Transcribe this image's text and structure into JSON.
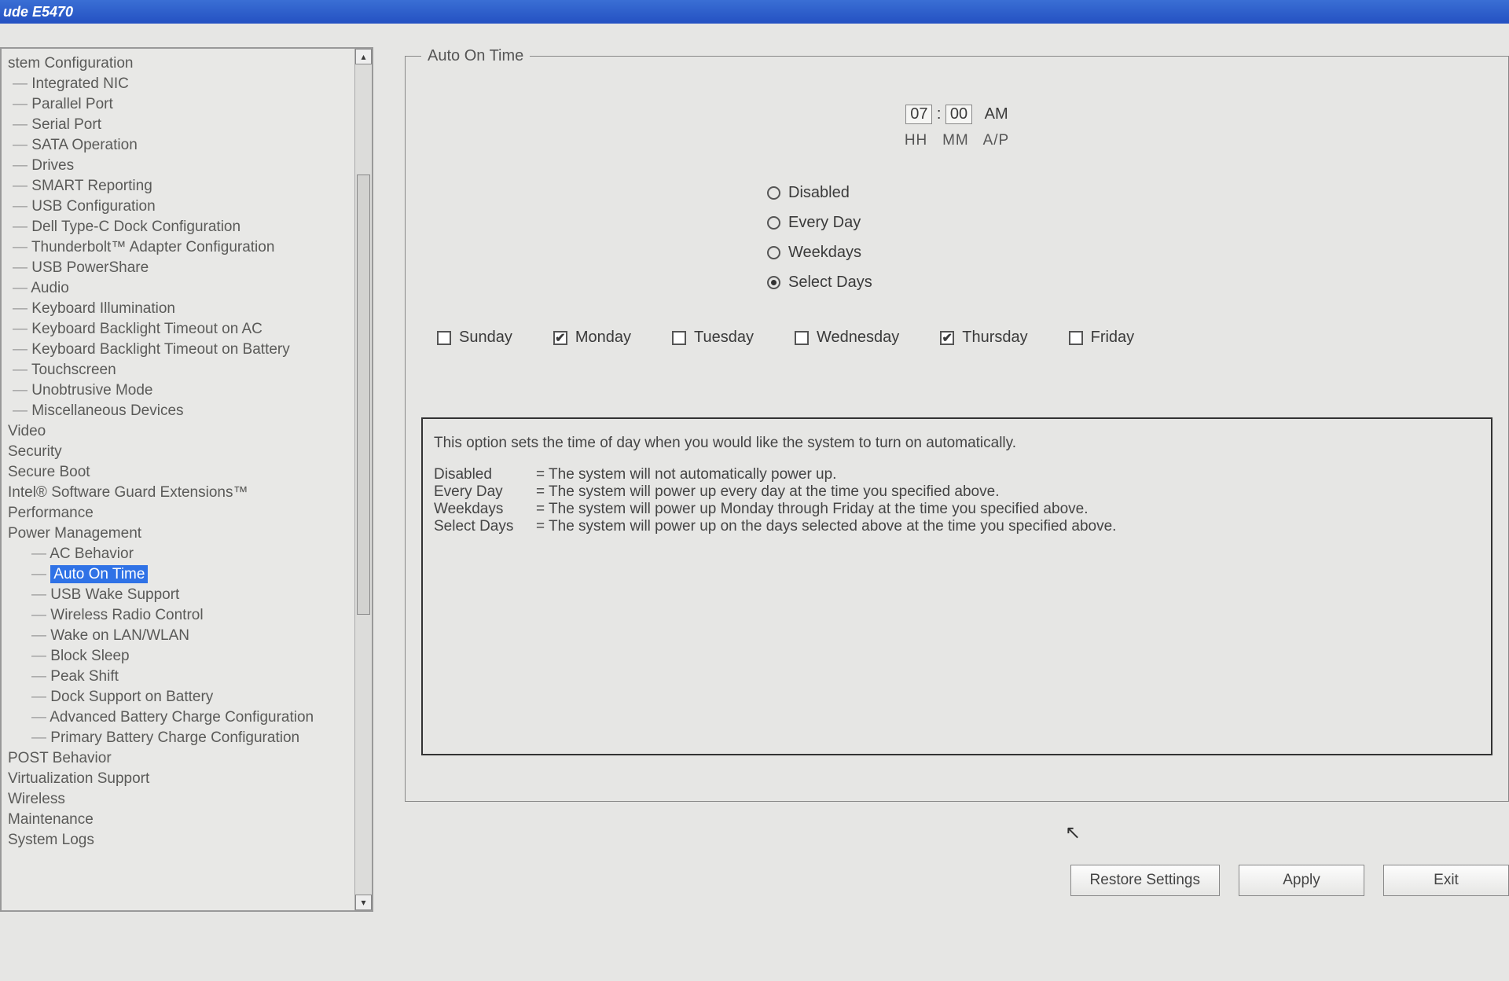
{
  "title": "ude E5470",
  "tree": {
    "cats": [
      {
        "label": "stem Configuration",
        "children": [
          "Integrated NIC",
          "Parallel Port",
          "Serial Port",
          "SATA Operation",
          "Drives",
          "SMART Reporting",
          "USB Configuration",
          "Dell Type-C Dock Configuration",
          "Thunderbolt™ Adapter Configuration",
          "USB PowerShare",
          "Audio",
          "Keyboard Illumination",
          "Keyboard Backlight Timeout on AC",
          "Keyboard Backlight Timeout on Battery",
          "Touchscreen",
          "Unobtrusive Mode",
          "Miscellaneous Devices"
        ]
      },
      {
        "label": "Video",
        "children": []
      },
      {
        "label": "Security",
        "children": []
      },
      {
        "label": "Secure Boot",
        "children": []
      },
      {
        "label": "Intel® Software Guard Extensions™",
        "children": []
      },
      {
        "label": "Performance",
        "children": []
      },
      {
        "label": "Power Management",
        "children": [
          "AC Behavior",
          "Auto On Time",
          "USB Wake Support",
          "Wireless Radio Control",
          "Wake on LAN/WLAN",
          "Block Sleep",
          "Peak Shift",
          "Dock Support on Battery",
          "Advanced Battery Charge Configuration",
          "Primary Battery Charge Configuration"
        ],
        "selected": "Auto On Time",
        "deep": true
      },
      {
        "label": "POST Behavior",
        "children": []
      },
      {
        "label": "Virtualization Support",
        "children": []
      },
      {
        "label": "Wireless",
        "children": []
      },
      {
        "label": "Maintenance",
        "children": []
      },
      {
        "label": "System Logs",
        "children": []
      }
    ]
  },
  "panel": {
    "legend": "Auto On Time",
    "time": {
      "hh": "07",
      "mm": "00",
      "ap": "AM",
      "hh_lbl": "HH",
      "mm_lbl": "MM",
      "ap_lbl": "A/P"
    },
    "options": [
      {
        "label": "Disabled",
        "checked": false
      },
      {
        "label": "Every Day",
        "checked": false
      },
      {
        "label": "Weekdays",
        "checked": false
      },
      {
        "label": "Select Days",
        "checked": true
      }
    ],
    "days": [
      {
        "label": "Sunday",
        "checked": false
      },
      {
        "label": "Monday",
        "checked": true
      },
      {
        "label": "Tuesday",
        "checked": false
      },
      {
        "label": "Wednesday",
        "checked": false
      },
      {
        "label": "Thursday",
        "checked": true
      },
      {
        "label": "Friday",
        "checked": false
      }
    ],
    "desc_intro": "This option sets the time of day when you would like the system to turn on automatically.",
    "desc_rows": [
      {
        "k": "Disabled",
        "v": "= The system will not automatically power up."
      },
      {
        "k": "Every Day",
        "v": "= The system will power up every day at the time you specified above."
      },
      {
        "k": "Weekdays",
        "v": "= The system will power up Monday through Friday at the time you specified above."
      },
      {
        "k": "Select Days",
        "v": "= The system will power up on the days selected above at the time you specified above."
      }
    ]
  },
  "buttons": {
    "restore": "Restore Settings",
    "apply": "Apply",
    "exit": "Exit"
  }
}
